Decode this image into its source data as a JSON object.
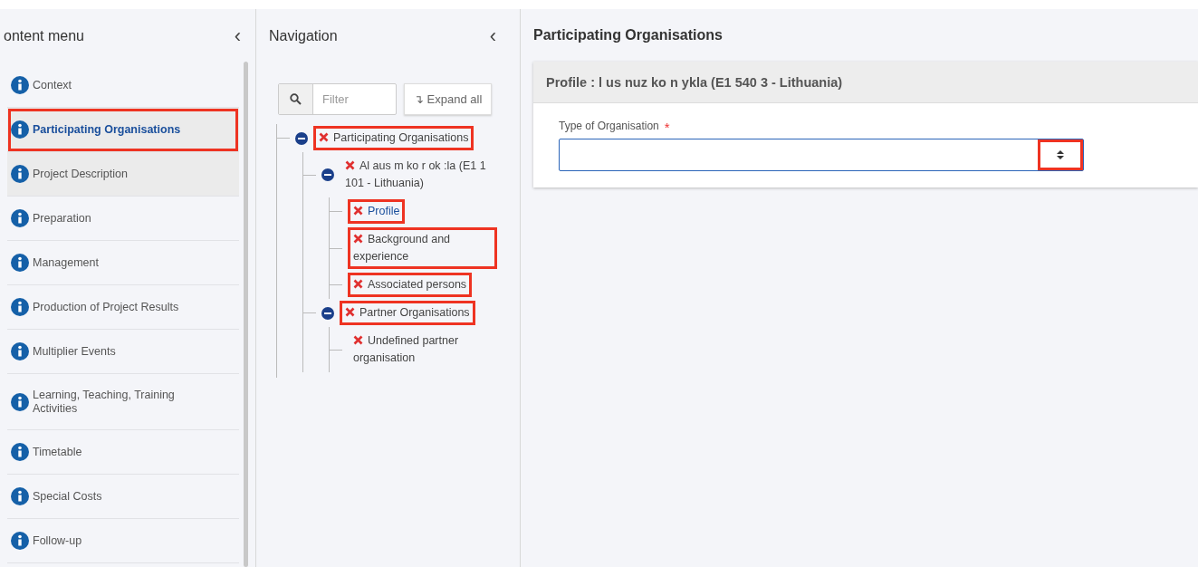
{
  "content_menu": {
    "title": "ontent menu",
    "collapse": "‹",
    "items": [
      {
        "label": "Context",
        "selected": false,
        "hovered": false,
        "highlighted": false
      },
      {
        "label": "Participating Organisations",
        "selected": true,
        "hovered": false,
        "highlighted": true
      },
      {
        "label": "Project Description",
        "selected": false,
        "hovered": true,
        "highlighted": false
      },
      {
        "label": "Preparation",
        "selected": false,
        "hovered": false,
        "highlighted": false
      },
      {
        "label": "Management",
        "selected": false,
        "hovered": false,
        "highlighted": false
      },
      {
        "label": "Production of Project Results",
        "selected": false,
        "hovered": false,
        "highlighted": false
      },
      {
        "label": "Multiplier Events",
        "selected": false,
        "hovered": false,
        "highlighted": false
      },
      {
        "label": "Learning, Teaching, Training Activities",
        "selected": false,
        "hovered": false,
        "highlighted": false
      },
      {
        "label": "Timetable",
        "selected": false,
        "hovered": false,
        "highlighted": false
      },
      {
        "label": "Special Costs",
        "selected": false,
        "hovered": false,
        "highlighted": false
      },
      {
        "label": "Follow-up",
        "selected": false,
        "hovered": false,
        "highlighted": false
      }
    ]
  },
  "navigation": {
    "title": "Navigation",
    "collapse": "‹",
    "filter": {
      "placeholder": "Filter"
    },
    "expand_all": "↴ Expand all",
    "tree": [
      {
        "label": "Participating Organisations",
        "error": true,
        "expanded": true,
        "selected": false,
        "highlighted": true,
        "children": [
          {
            "label": "Al  aus m   ko   r  ok  :la (E1 1   101  - Lithuania)",
            "error": true,
            "expanded": true,
            "selected": false,
            "highlighted": false,
            "children": [
              {
                "label": "Profile",
                "error": true,
                "selected": true,
                "highlighted": true
              },
              {
                "label": "Background and experience",
                "error": true,
                "selected": false,
                "highlighted": true
              },
              {
                "label": "Associated persons",
                "error": true,
                "selected": false,
                "highlighted": true
              }
            ]
          },
          {
            "label": "Partner Organisations",
            "error": true,
            "expanded": true,
            "selected": false,
            "highlighted": true,
            "children": [
              {
                "label": "Undefined partner organisation",
                "error": true,
                "selected": false,
                "highlighted": false
              }
            ]
          }
        ]
      }
    ]
  },
  "main": {
    "title": "Participating Organisations",
    "card_header": "Profile :  l  us  nuz  ko   n  ykla (E1  540  3 - Lithuania)",
    "field": {
      "label": "Type of Organisation",
      "required_mark": "*",
      "arrow_highlighted": true
    }
  }
}
